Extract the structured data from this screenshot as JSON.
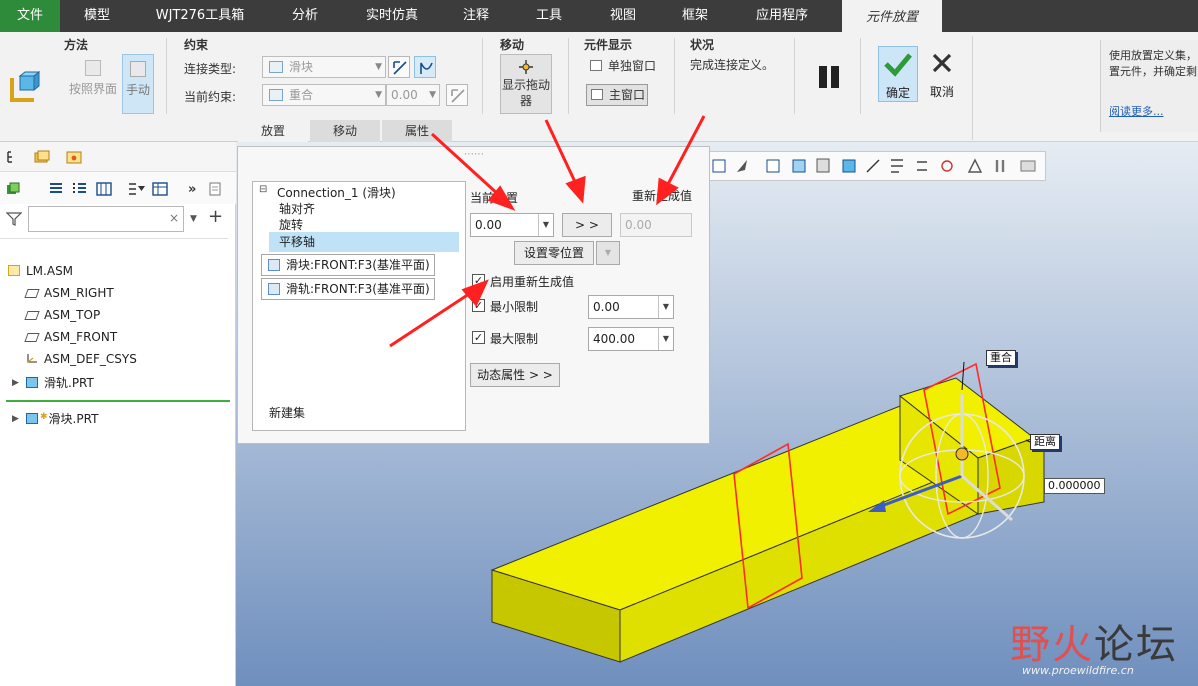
{
  "menu": {
    "tabs": [
      "文件",
      "模型",
      "WJT276工具箱",
      "分析",
      "实时仿真",
      "注释",
      "工具",
      "视图",
      "框架",
      "应用程序",
      "元件放置"
    ]
  },
  "ribbon": {
    "method": {
      "title": "方法",
      "auto_label": "按照界面",
      "manual_label": "手动"
    },
    "constraints": {
      "title": "约束",
      "conn_type_label": "连接类型:",
      "conn_type_value": "滑块",
      "current_label": "当前约束:",
      "current_value": "重合",
      "offset_value": "0.00"
    },
    "move": {
      "title": "移动",
      "drag_label": "显示拖动器"
    },
    "display": {
      "title": "元件显示",
      "separate_window": "单独窗口",
      "main_window": "主窗口"
    },
    "status": {
      "title": "状况",
      "text": "完成连接定义。"
    },
    "ok_label": "确定",
    "cancel_label": "取消",
    "subtabs": [
      "放置",
      "移动",
      "属性"
    ],
    "help": {
      "text_line1": "使用放置定义集，",
      "text_line2": "置元件，并确定剩",
      "link": "阅读更多..."
    }
  },
  "model_tree": {
    "filter_placeholder": "",
    "items": [
      "LM.ASM",
      "ASM_RIGHT",
      "ASM_TOP",
      "ASM_FRONT",
      "ASM_DEF_CSYS",
      "滑轨.PRT",
      "滑块.PRT"
    ]
  },
  "dialog": {
    "connection": "Connection_1 (滑块)",
    "sub_items": [
      "轴对齐",
      "旋转",
      "平移轴"
    ],
    "refs": [
      "滑块:FRONT:F3(基准平面)",
      "滑轨:FRONT:F3(基准平面)"
    ],
    "new_set": "新建集",
    "current_pos_label": "当前位置",
    "current_pos_value": "0.00",
    "apply_btn": "> >",
    "regen_label": "重新生成值",
    "regen_value": "0.00",
    "set_zero_btn": "设置零位置",
    "enable_regen": "启用重新生成值",
    "min_limit_label": "最小限制",
    "min_limit_value": "0.00",
    "max_limit_label": "最大限制",
    "max_limit_value": "400.00",
    "dynamic_btn": "动态属性 > >"
  },
  "graphics": {
    "tag_coincide": "重合",
    "tag_distance": "距离",
    "distance_value": "0.000000"
  },
  "watermark": {
    "part1": "野火",
    "part2": "论坛",
    "url": "www.proewildfire.cn"
  },
  "colors": {
    "file_tab": "#2e8b3a",
    "part": "#f0f000",
    "accent": "#ff2020"
  }
}
